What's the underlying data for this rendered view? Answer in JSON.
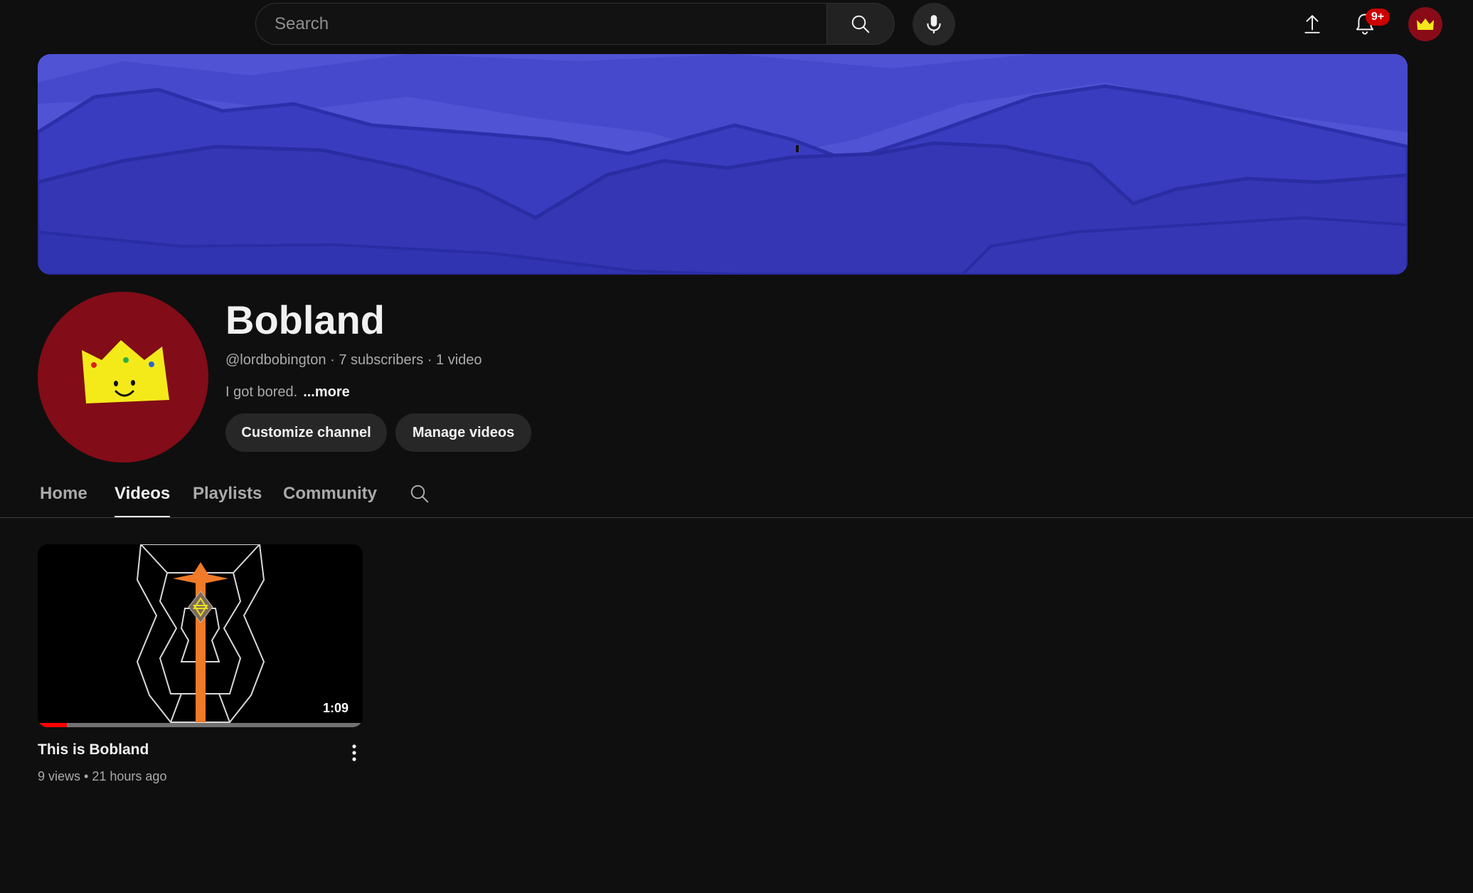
{
  "topbar": {
    "search_placeholder": "Search",
    "notifications_badge": "9+",
    "icons": [
      "search-icon",
      "mic-icon",
      "upload-icon",
      "bell-icon",
      "crown-avatar-icon"
    ]
  },
  "channel": {
    "name": "Bobland",
    "handle": "@lordbobington",
    "subscribers": "7 subscribers",
    "video_count": "1 video",
    "separator": "·",
    "description": "I got bored.",
    "more_label": "...more",
    "customize_label": "Customize channel",
    "manage_label": "Manage videos",
    "avatar_color": "#820c17",
    "banner_color": "#3a3bc0"
  },
  "tabs": [
    {
      "label": "Home",
      "active": false
    },
    {
      "label": "Videos",
      "active": true
    },
    {
      "label": "Playlists",
      "active": false
    },
    {
      "label": "Community",
      "active": false
    }
  ],
  "videos": [
    {
      "title": "This is Bobland",
      "views": "9 views",
      "separator": "•",
      "age": "21 hours ago",
      "duration": "1:09",
      "watched_fraction": 0.09
    }
  ],
  "colors": {
    "background": "#0f0f0f",
    "badge": "#cc0000",
    "progress": "#ff0000"
  }
}
